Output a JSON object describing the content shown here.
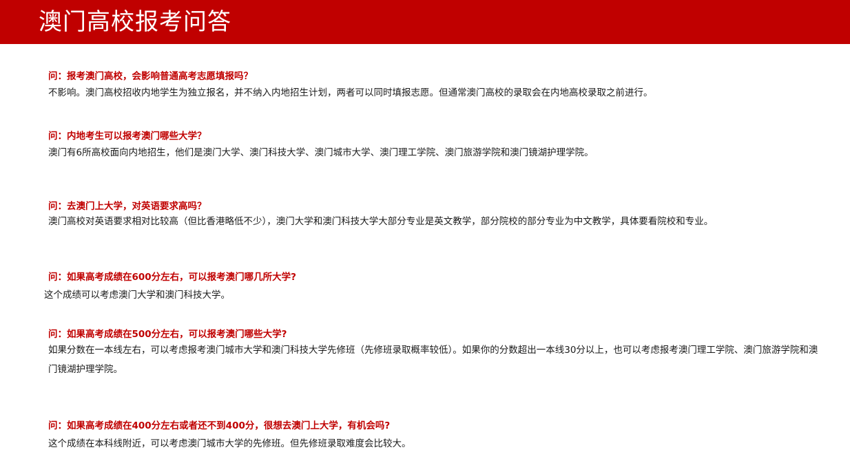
{
  "header": {
    "title": "澳门高校报考问答"
  },
  "accent_color": "#c00000",
  "qa": [
    {
      "question": "问：报考澳门高校，会影响普通高考志愿填报吗？",
      "answer": "不影响。澳门高校招收内地学生为独立报名，并不纳入内地招生计划，两者可以同时填报志愿。但通常澳门高校的录取会在内地高校录取之前进行。"
    },
    {
      "question": "问：内地考生可以报考澳门哪些大学？",
      "answer": "澳门有6所高校面向内地招生，他们是澳门大学、澳门科技大学、澳门城市大学、澳门理工学院、澳门旅游学院和澳门镜湖护理学院。"
    },
    {
      "question": "问：去澳门上大学，对英语要求高吗？",
      "answer": "澳门高校对英语要求相对比较高（但比香港略低不少），澳门大学和澳门科技大学大部分专业是英文教学，部分院校的部分专业为中文教学，具体要看院校和专业。"
    },
    {
      "question": "问：如果高考成绩在600分左右，可以报考澳门哪几所大学?",
      "answer": "这个成绩可以考虑澳门大学和澳门科技大学。"
    },
    {
      "question": "问：如果高考成绩在500分左右，可以报考澳门哪些大学?",
      "answer": "如果分数在一本线左右，可以考虑报考澳门城市大学和澳门科技大学先修班（先修班录取概率较低）。如果你的分数超出一本线30分以上，也可以考虑报考澳门理工学院、澳门旅游学院和澳门镜湖护理学院。"
    },
    {
      "question": "问：如果高考成绩在400分左右或者还不到400分，很想去澳门上大学，有机会吗?",
      "answer": "这个成绩在本科线附近，可以考虑澳门城市大学的先修班。但先修班录取难度会比较大。"
    }
  ]
}
